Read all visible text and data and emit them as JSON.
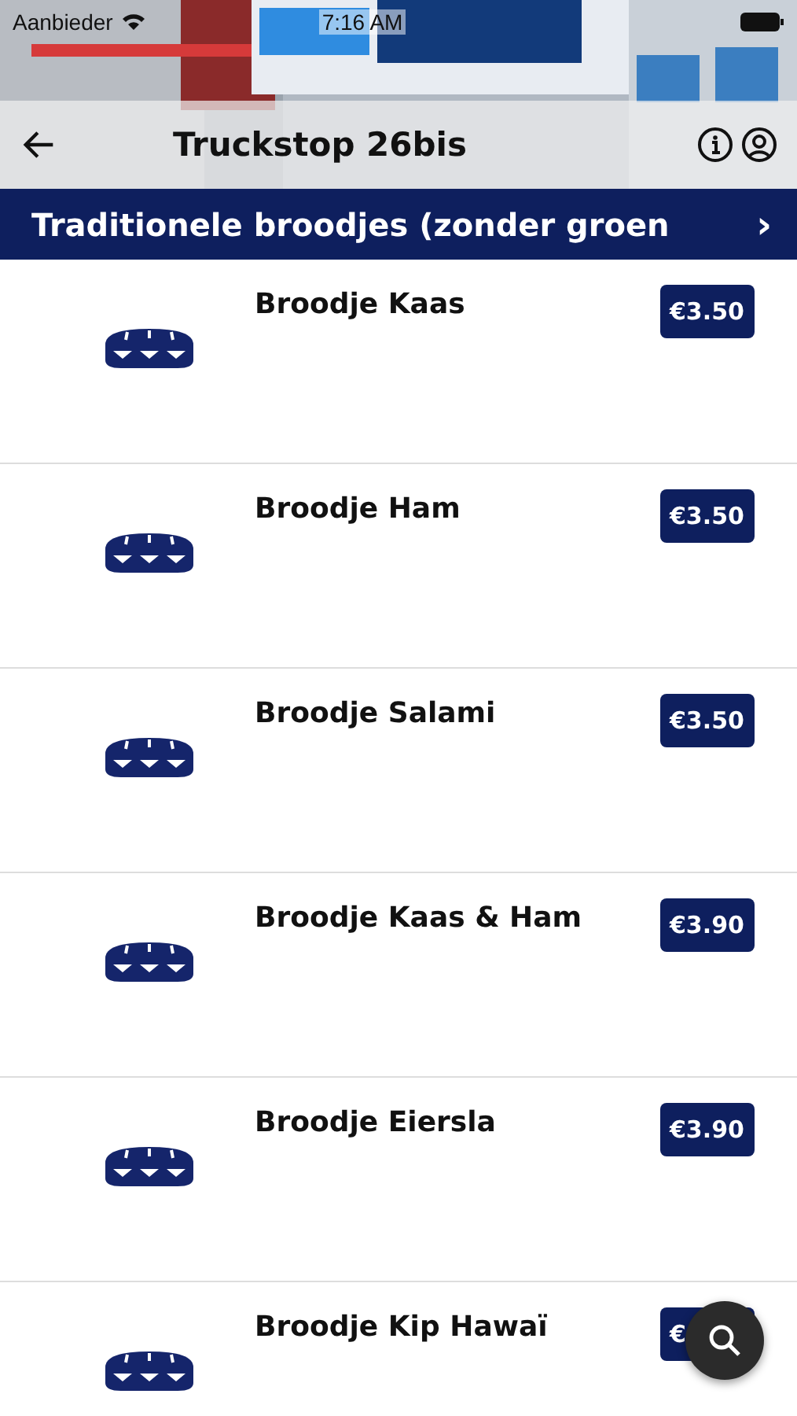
{
  "status_bar": {
    "carrier": "Aanbieder",
    "time": "7:16 AM"
  },
  "header": {
    "title": "Truckstop 26bis"
  },
  "category": {
    "title": "Traditionele broodjes (zonder groen",
    "chevron": "›"
  },
  "products": [
    {
      "name": "Broodje Kaas",
      "price": "€3.50"
    },
    {
      "name": "Broodje Ham",
      "price": "€3.50"
    },
    {
      "name": "Broodje Salami",
      "price": "€3.50"
    },
    {
      "name": "Broodje Kaas & Ham",
      "price": "€3.90"
    },
    {
      "name": "Broodje Eiersla",
      "price": "€3.90"
    },
    {
      "name": "Broodje Kip Hawaï",
      "price": "€"
    }
  ]
}
